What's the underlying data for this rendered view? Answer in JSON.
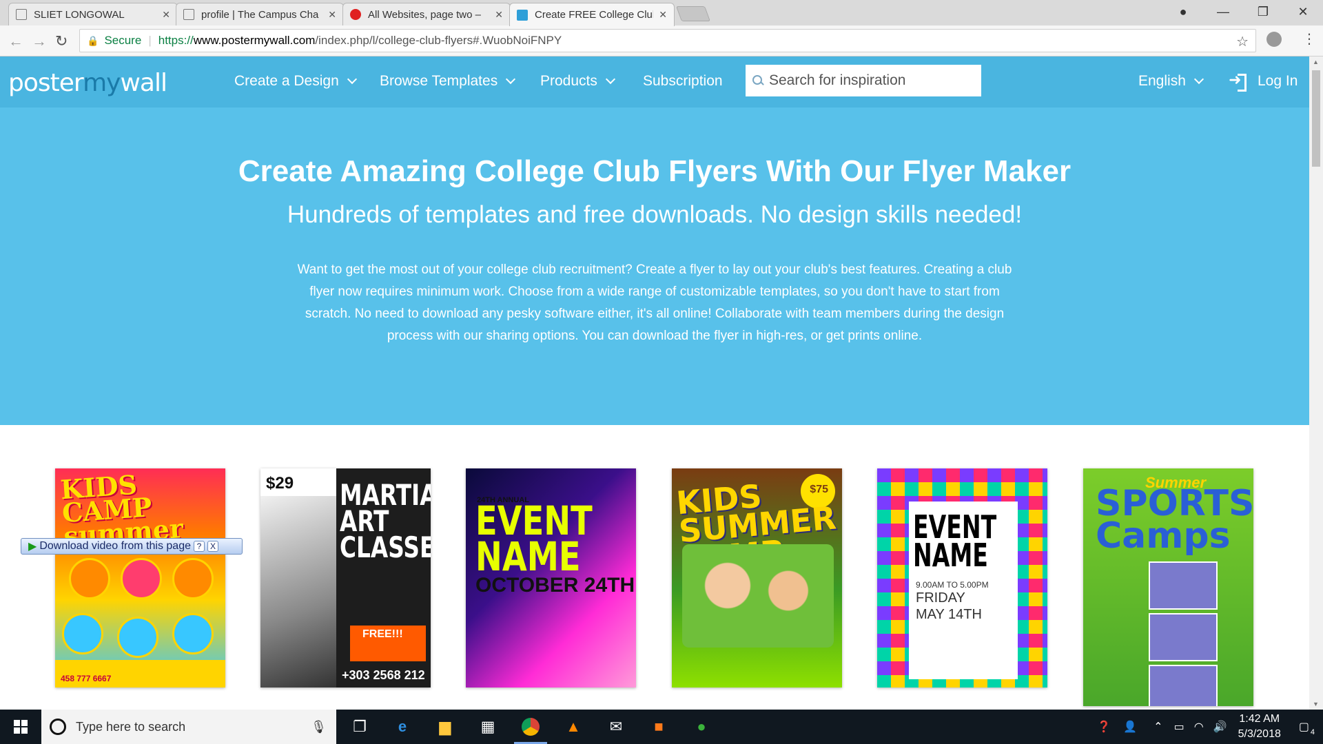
{
  "browser": {
    "tabs": [
      {
        "title": "SLIET LONGOWAL",
        "favicon_color": "#777777"
      },
      {
        "title": "profile | The Campus Cha",
        "favicon_color": "#777777"
      },
      {
        "title": "All Websites, page two –",
        "favicon_color": "#e02020"
      },
      {
        "title": "Create FREE College Club",
        "favicon_color": "#2f9fd8"
      }
    ],
    "secure_label": "Secure",
    "url_prefix": "https://",
    "url_domain": "www.postermywall.com",
    "url_path": "/index.php/l/college-club-flyers#.WuobNoiFNPY"
  },
  "site": {
    "logo_parts": [
      "poster",
      "my",
      "wall"
    ],
    "nav": [
      {
        "label": "Create a Design",
        "dropdown": true
      },
      {
        "label": "Browse Templates",
        "dropdown": true
      },
      {
        "label": "Products",
        "dropdown": true
      },
      {
        "label": "Subscription",
        "dropdown": false
      }
    ],
    "search_placeholder": "Search for inspiration",
    "language": "English",
    "login": "Log In",
    "brand_color": "#4ab5e0"
  },
  "hero": {
    "title": "Create Amazing College Club Flyers With Our Flyer Maker",
    "subtitle": "Hundreds of templates and free downloads. No design skills needed!",
    "body": "Want to get the most out of your college club recruitment? Create a flyer to lay out your club's best features. Creating a club flyer now requires minimum work. Choose from a wide range of customizable templates, so you don't have to start from scratch. No need to download any pesky software either, it's all online! Collaborate with team members during the design process with our sharing options. You can download the flyer in high-res, or get prints online."
  },
  "templates": [
    {
      "title": "KIDS CAMP summer",
      "footer": "458 777 6667"
    },
    {
      "title": "MARTIAL ART CLASSES",
      "price": "$29",
      "cta": "FREE!!!",
      "phone": "+303 2568 212"
    },
    {
      "title": "EVENT NAME",
      "kicker": "24TH ANNUAL",
      "date": "OCTOBER 24TH"
    },
    {
      "title": "KIDS SUMMER CAMP",
      "badge": "$75"
    },
    {
      "title": "EVENT NAME",
      "time": "9.00AM TO 5.00PM",
      "day": "FRIDAY",
      "date": "MAY 14TH"
    },
    {
      "title": "SPORTS Camps",
      "kicker": "Summer"
    }
  ],
  "overlay": {
    "label": "Download video from this page",
    "help": "?",
    "close": "X"
  },
  "taskbar": {
    "search_placeholder": "Type here to search",
    "time": "1:42 AM",
    "date": "5/3/2018",
    "notifications": "4"
  }
}
